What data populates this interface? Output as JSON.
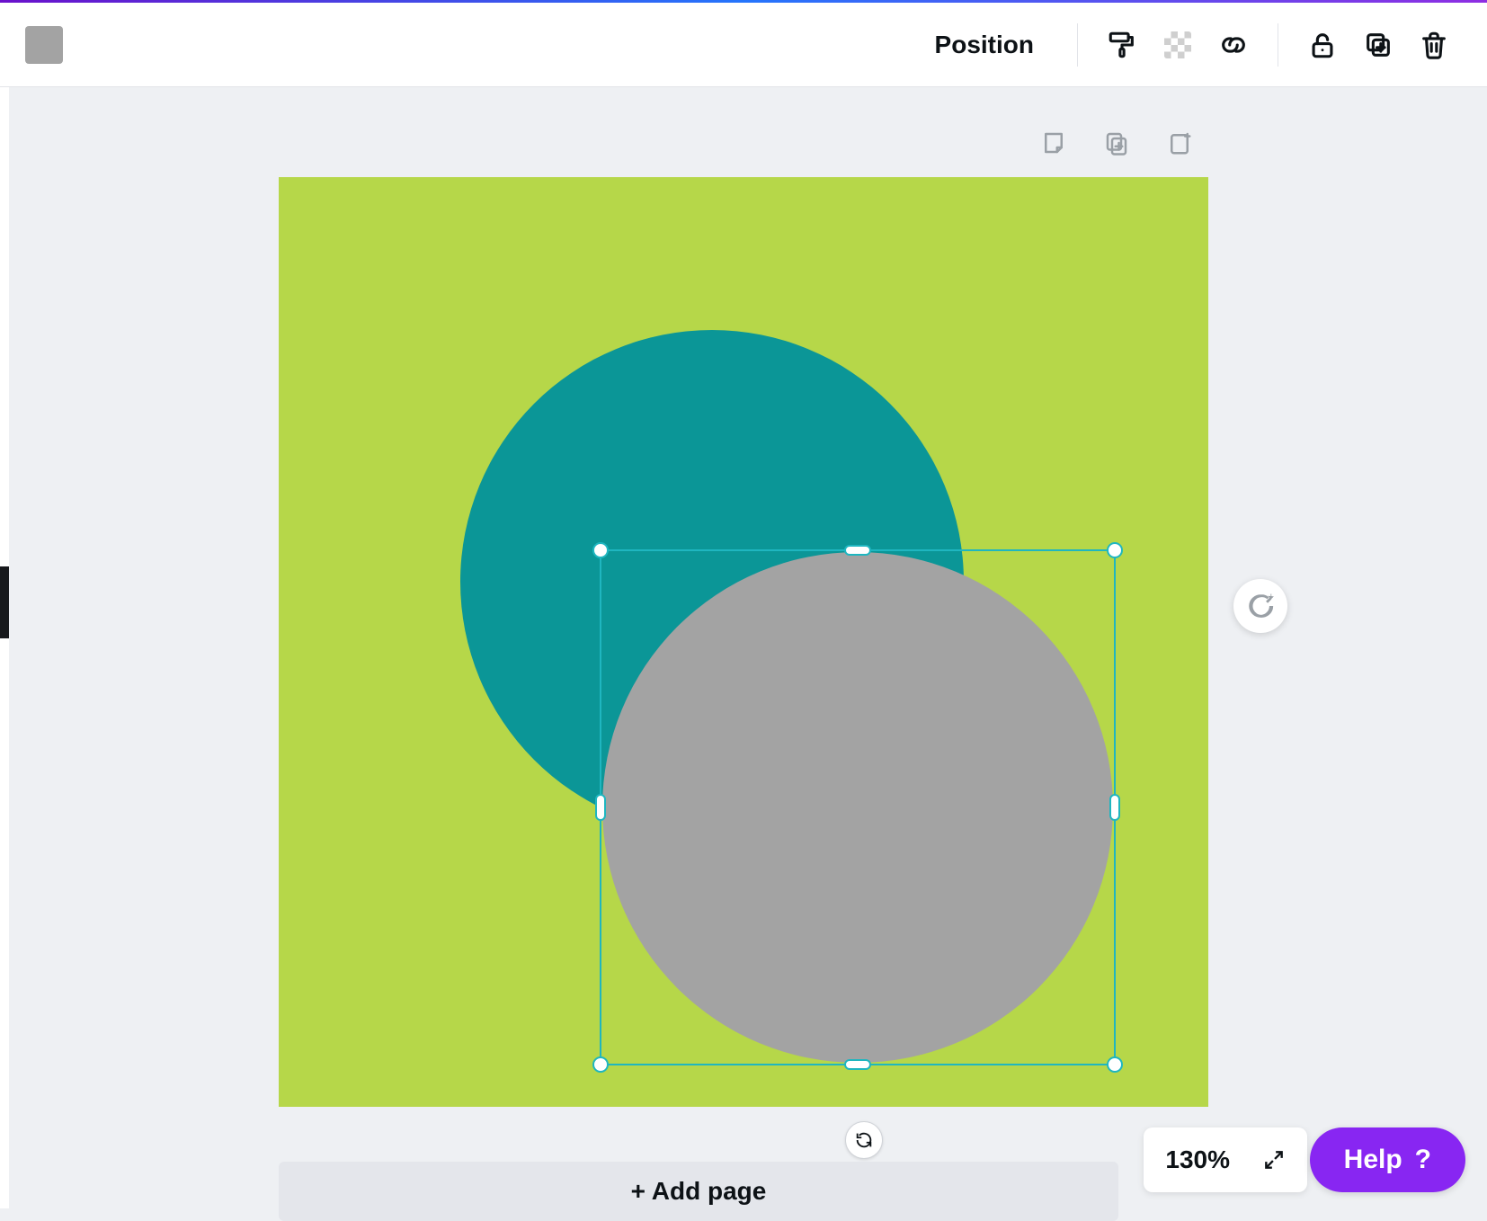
{
  "toolbar": {
    "selected_fill_color": "#a3a3a3",
    "position_label": "Position",
    "icons": {
      "paint_roller": "paint-roller-icon",
      "transparency": "transparency-icon",
      "link": "link-icon",
      "lock": "lock-icon",
      "duplicate": "duplicate-icon",
      "delete": "trash-icon"
    }
  },
  "page_controls": {
    "notes": "notes-icon",
    "duplicate_page": "duplicate-page-icon",
    "add_page": "add-page-icon"
  },
  "canvas": {
    "page_bg": "#b6d749",
    "shapes": [
      {
        "type": "circle",
        "fill": "#0b9697",
        "selected": false
      },
      {
        "type": "circle",
        "fill": "#a3a3a3",
        "selected": true
      }
    ],
    "selection_border_color": "#1fb6c0"
  },
  "add_page_label": "+ Add page",
  "zoom": {
    "level_label": "130%"
  },
  "help": {
    "label": "Help",
    "glyph": "?"
  },
  "colors": {
    "accent_purple": "#8826f2"
  }
}
